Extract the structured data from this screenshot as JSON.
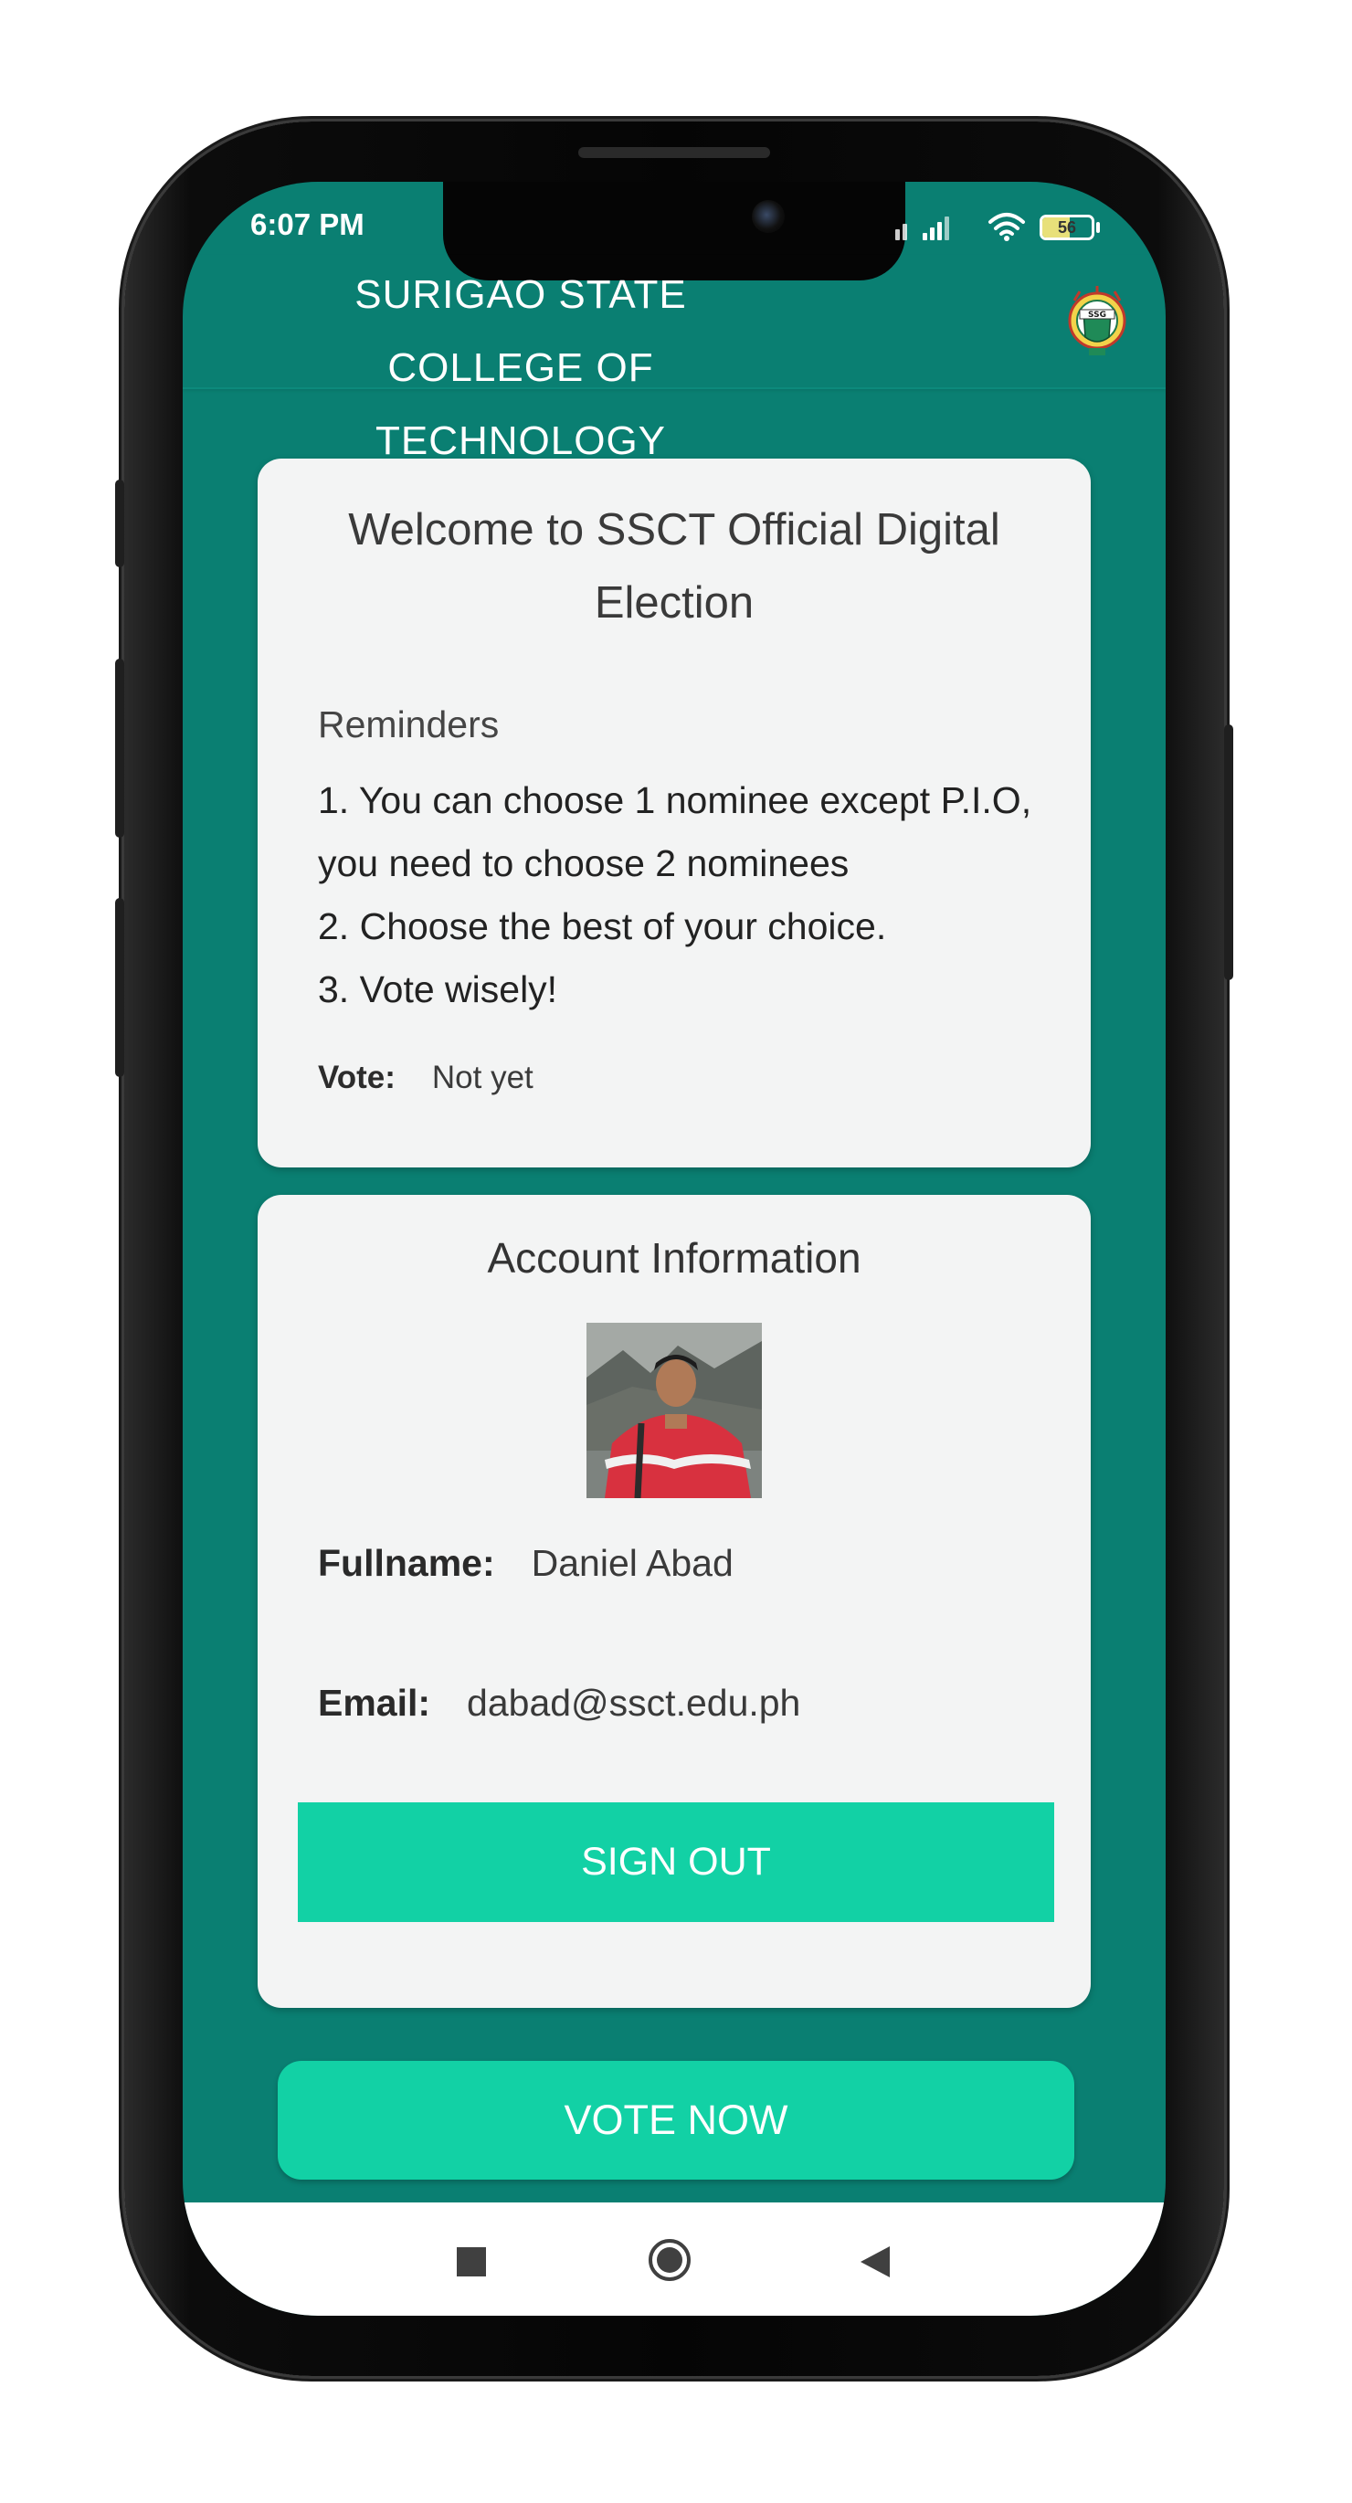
{
  "status_bar": {
    "time": "6:07 PM",
    "battery_level": "56",
    "battery_fraction": 0.56,
    "icons": [
      "signal-icon",
      "wifi-icon",
      "battery-icon"
    ]
  },
  "header": {
    "title": "SURIGAO STATE COLLEGE OF TECHNOLOGY",
    "logo_icon": "ssg-seal-logo"
  },
  "welcome_card": {
    "title": "Welcome to SSCT Official Digital Election",
    "reminders_heading": "Reminders",
    "reminders": [
      "1. You can choose 1 nominee except P.I.O, you need to choose 2 nominees",
      "2. Choose the best of your choice.",
      "3. Vote wisely!"
    ],
    "vote_label": "Vote:",
    "vote_status": "Not yet"
  },
  "account_card": {
    "title": "Account Information",
    "fullname_label": "Fullname:",
    "fullname_value": "Daniel Abad",
    "email_label": "Email:",
    "email_value": "dabad@ssct.edu.ph",
    "sign_out_label": "SIGN OUT"
  },
  "vote_now_label": "VOTE NOW",
  "nav_bar": {
    "icons": [
      "recent-apps-icon",
      "home-icon",
      "back-icon"
    ]
  },
  "colors": {
    "background": "#0a7f72",
    "accent_button": "#12d1a5",
    "card": "#f3f4f4"
  }
}
